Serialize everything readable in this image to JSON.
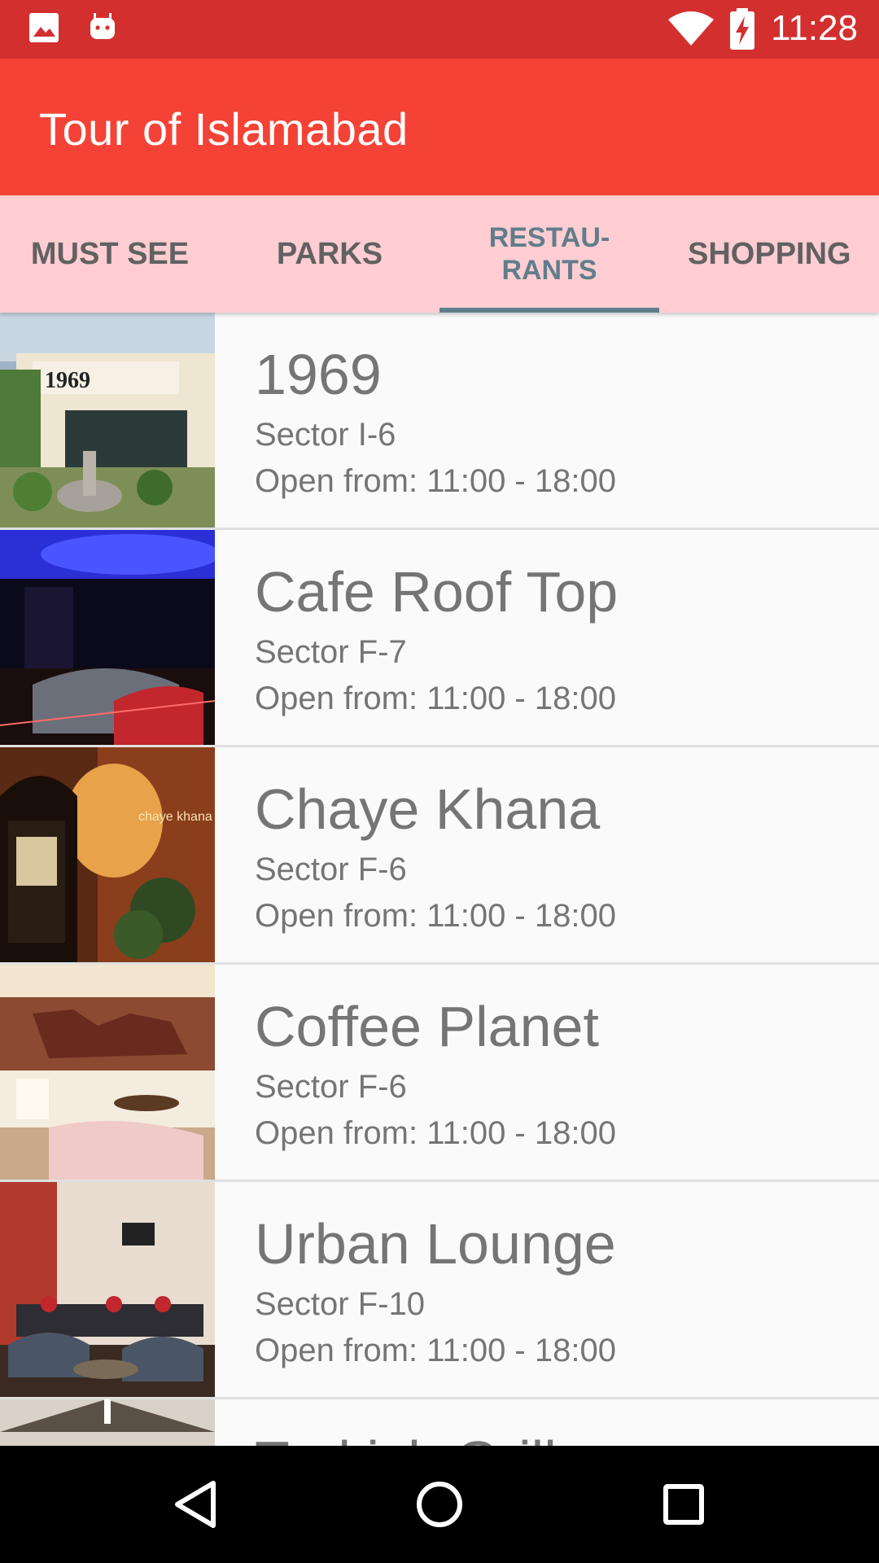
{
  "status_bar": {
    "time": "11:28",
    "icons": [
      "gallery-icon",
      "android-icon",
      "wifi-icon",
      "battery-charging-icon"
    ]
  },
  "app_bar": {
    "title": "Tour of Islamabad"
  },
  "tabs": [
    {
      "label": "MUST SEE",
      "active": false
    },
    {
      "label": "PARKS",
      "active": false
    },
    {
      "label": "RESTAU-\nRANTS",
      "active": true
    },
    {
      "label": "SHOPPING",
      "active": false
    }
  ],
  "colors": {
    "status_bar": "#d32f2f",
    "app_bar": "#f44336",
    "tab_bar": "#ffcdd2",
    "tab_active": "#607d8b",
    "text_secondary": "#757575"
  },
  "restaurants": [
    {
      "name": "1969",
      "sector": "Sector I-6",
      "hours": "Open from: 11:00 - 18:00"
    },
    {
      "name": "Cafe Roof Top",
      "sector": "Sector F-7",
      "hours": "Open from: 11:00 - 18:00"
    },
    {
      "name": "Chaye Khana",
      "sector": "Sector F-6",
      "hours": "Open from: 11:00 - 18:00"
    },
    {
      "name": "Coffee Planet",
      "sector": "Sector F-6",
      "hours": "Open from: 11:00 - 18:00"
    },
    {
      "name": "Urban Lounge",
      "sector": "Sector F-10",
      "hours": "Open from: 11:00 - 18:00"
    },
    {
      "name": "Turkish Grill",
      "sector": "",
      "hours": ""
    }
  ],
  "nav_bar": {
    "buttons": [
      "back-icon",
      "home-icon",
      "recents-icon"
    ]
  }
}
